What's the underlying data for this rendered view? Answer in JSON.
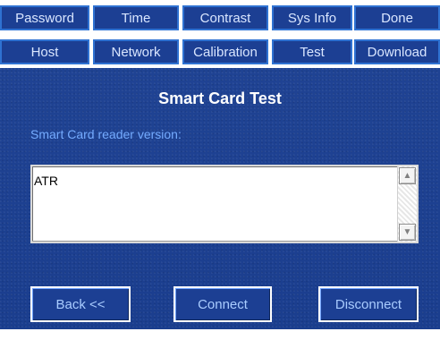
{
  "nav": {
    "row1": [
      "Password",
      "Time",
      "Contrast",
      "Sys Info",
      "Done"
    ],
    "row2": [
      "Host",
      "Network",
      "Calibration",
      "Test",
      "Download"
    ]
  },
  "page": {
    "title": "Smart Card Test",
    "subtitle": "Smart Card reader version:"
  },
  "output": {
    "text": "ATR"
  },
  "scrollbar": {
    "up_icon": "▲",
    "down_icon": "▼"
  },
  "buttons": {
    "back": "Back <<",
    "connect": "Connect",
    "disconnect": "Disconnect"
  },
  "colors": {
    "panel": "#1b3f91",
    "tab": "#1c3f93",
    "tab_border": "#2f72d2",
    "title": "#ffffff",
    "subtitle": "#74abff",
    "button_text": "#a9ccff"
  }
}
